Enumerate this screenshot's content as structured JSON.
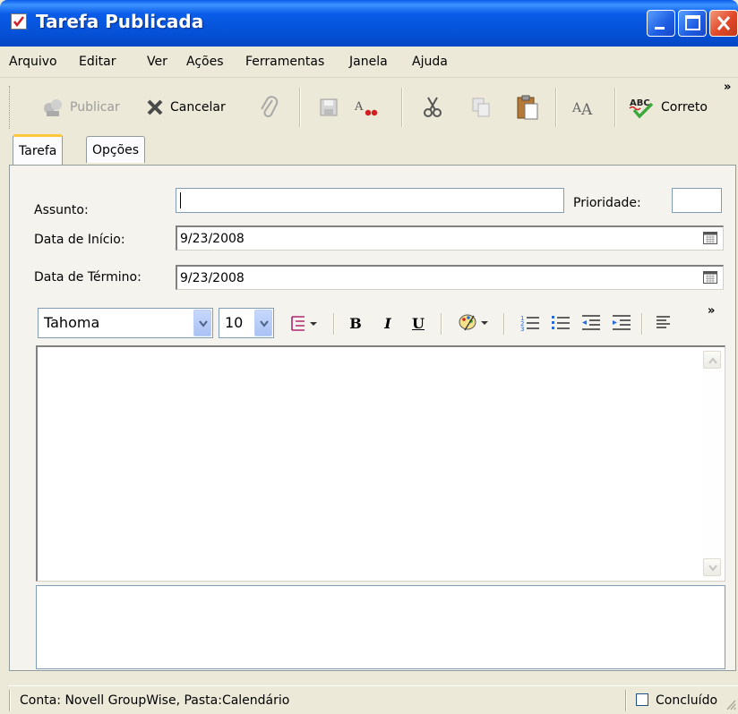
{
  "window": {
    "title": "Tarefa Publicada",
    "accent": "#0a5ce8",
    "close_color": "#e1482a"
  },
  "menu": {
    "items": [
      {
        "label": "Arquivo"
      },
      {
        "label": "Editar"
      },
      {
        "label": "Ver"
      },
      {
        "label": "Ações"
      },
      {
        "label": "Ferramentas"
      },
      {
        "label": "Janela"
      },
      {
        "label": "Ajuda"
      }
    ]
  },
  "toolbar": {
    "publicar_label": "Publicar",
    "cancelar_label": "Cancelar",
    "corretor_label": "Correto",
    "more_chevron": "»",
    "icons": [
      "publish-icon",
      "cancel-icon",
      "attach-icon",
      "save-icon",
      "spell-color-icon",
      "cut-icon",
      "copy-icon",
      "paste-icon",
      "font-icon",
      "spellcheck-icon"
    ]
  },
  "tabs": [
    {
      "label": "Tarefa",
      "active": true
    },
    {
      "label": "Opções",
      "active": false
    }
  ],
  "form": {
    "assunto_label": "Assunto:",
    "assunto_value": "",
    "prioridade_label": "Prioridade:",
    "prioridade_value": "",
    "data_inicio_label": "Data de Início:",
    "data_inicio_value": "9/23/2008",
    "data_termino_label": "Data de Término:",
    "data_termino_value": "9/23/2008"
  },
  "format_bar": {
    "font_value": "Tahoma",
    "size_value": "10",
    "bold": "B",
    "italic": "I",
    "underline": "U",
    "more_chevron": "»"
  },
  "status": {
    "text": "Conta: Novell GroupWise,  Pasta:Calendário",
    "concluido_label": "Concluído",
    "concluido_checked": false
  }
}
